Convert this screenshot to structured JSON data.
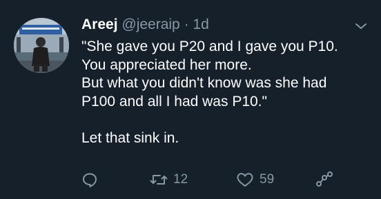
{
  "tweet": {
    "author_name": "Areej",
    "handle": "@jeeraip",
    "separator": "·",
    "time": "1d",
    "lines": [
      "\"She gave you P20 and I gave you P10.",
      "You appreciated her more.",
      "But what you didn't know was she had",
      "P100 and all I had was P10.\""
    ],
    "closing_line": "Let that sink in.",
    "retweet_count": "12",
    "like_count": "59"
  },
  "icons": {
    "reply": "reply-icon",
    "retweet": "retweet-icon",
    "like": "heart-icon",
    "share": "share-icon",
    "menu": "chevron-down-icon"
  },
  "colors": {
    "background": "#15202b",
    "text": "#ffffff",
    "secondary": "#8899a6"
  }
}
